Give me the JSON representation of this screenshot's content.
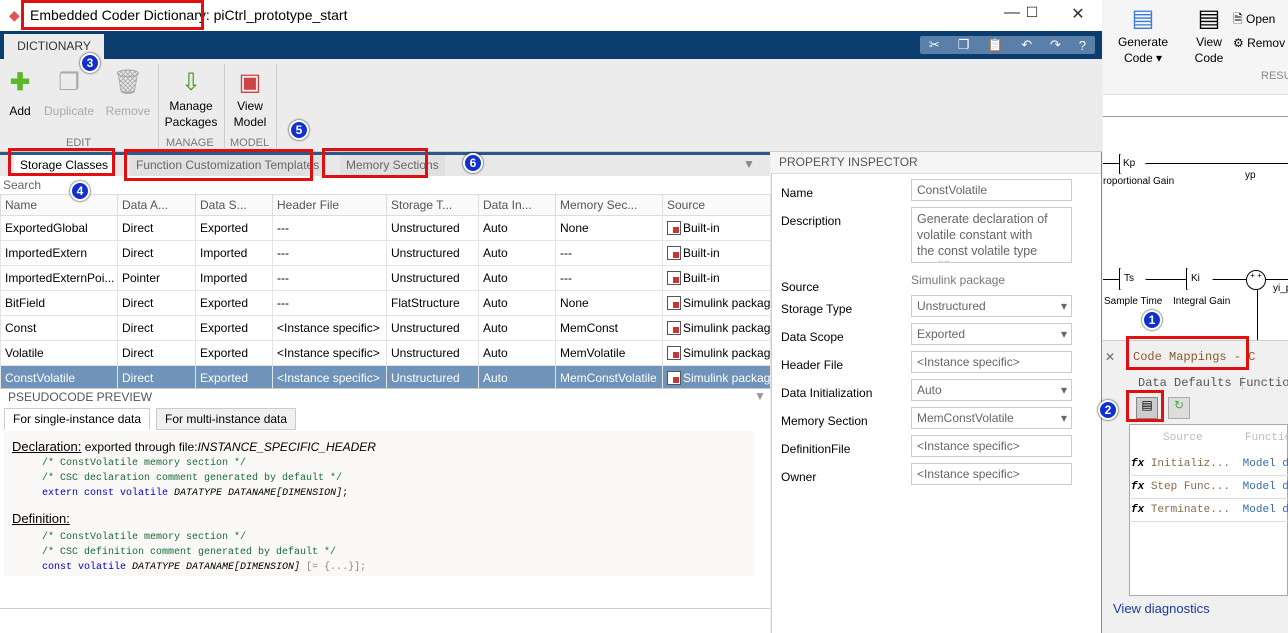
{
  "window": {
    "title": "Embedded Coder Dictionary: piCtrl_prototype_start",
    "tab": "DICTIONARY"
  },
  "ribbon": {
    "add": "Add",
    "duplicate": "Duplicate",
    "remove": "Remove",
    "edit_group": "EDIT",
    "manage_packages": [
      "Manage",
      "Packages"
    ],
    "manage_group": "MANAGE",
    "view_model": [
      "View",
      "Model"
    ],
    "model_group": "MODEL"
  },
  "tabs": [
    "Storage Classes",
    "Function Customization Templates",
    "Memory Sections"
  ],
  "search_placeholder": "Search",
  "table": {
    "headers": [
      "Name",
      "Data A...",
      "Data S...",
      "Header File",
      "Storage T...",
      "Data In...",
      "Memory Sec...",
      "Source"
    ],
    "rows": [
      [
        "ExportedGlobal",
        "Direct",
        "Exported",
        "---",
        "Unstructured",
        "Auto",
        "None",
        "Built-in"
      ],
      [
        "ImportedExtern",
        "Direct",
        "Imported",
        "---",
        "Unstructured",
        "Auto",
        "---",
        "Built-in"
      ],
      [
        "ImportedExternPoi...",
        "Pointer",
        "Imported",
        "---",
        "Unstructured",
        "Auto",
        "---",
        "Built-in"
      ],
      [
        "BitField",
        "Direct",
        "Exported",
        "---",
        "FlatStructure",
        "Auto",
        "None",
        "Simulink package"
      ],
      [
        "Const",
        "Direct",
        "Exported",
        "<Instance specific>",
        "Unstructured",
        "Auto",
        "MemConst",
        "Simulink package"
      ],
      [
        "Volatile",
        "Direct",
        "Exported",
        "<Instance specific>",
        "Unstructured",
        "Auto",
        "MemVolatile",
        "Simulink package"
      ],
      [
        "ConstVolatile",
        "Direct",
        "Exported",
        "<Instance specific>",
        "Unstructured",
        "Auto",
        "MemConstVolatile",
        "Simulink package"
      ]
    ],
    "selected_row": 6
  },
  "pseudocode": {
    "title": "PSEUDOCODE PREVIEW",
    "tabs": [
      "For single-instance data",
      "For multi-instance data"
    ],
    "declaration_label": "Declaration:",
    "declaration_text": "exported through file:",
    "declaration_file": "INSTANCE_SPECIFIC_HEADER",
    "decl_lines": [
      "/* ConstVolatile memory section */",
      "/* CSC declaration comment generated by default */"
    ],
    "decl_kw": "extern const volatile",
    "decl_code": "DATATYPE DATANAME[DIMENSION]",
    "decl_end": ";",
    "definition_label": "Definition:",
    "def_lines": [
      "/* ConstVolatile memory section */",
      "/* CSC definition comment generated by default */"
    ],
    "def_kw": "const volatile",
    "def_code": "DATATYPE DATANAME[DIMENSION]",
    "def_end": " [= {...}];"
  },
  "inspector": {
    "title": "PROPERTY INSPECTOR",
    "fields": [
      {
        "label": "Name",
        "value": "ConstVolatile"
      },
      {
        "label": "Description",
        "value": "Generate declaration of volatile constant with the const volatile type qualifier"
      },
      {
        "label": "Source",
        "value": "Simulink package"
      },
      {
        "label": "Storage Type",
        "value": "Unstructured"
      },
      {
        "label": "Data Scope",
        "value": "Exported"
      },
      {
        "label": "Header File",
        "value": "<Instance specific>"
      },
      {
        "label": "Data Initialization",
        "value": "Auto"
      },
      {
        "label": "Memory Section",
        "value": "MemConstVolatile"
      },
      {
        "label": "DefinitionFile",
        "value": "<Instance specific>"
      },
      {
        "label": "Owner",
        "value": "<Instance specific>"
      }
    ]
  },
  "background": {
    "generate_code": [
      "Generate",
      "Code ▾"
    ],
    "view_code": [
      "View",
      "Code"
    ],
    "open": "Open",
    "remove": "Remov",
    "results_group": "RESU",
    "blocks": {
      "kp": "Kp",
      "prop_gain": "roportional Gain",
      "yp": "yp",
      "ts": "Ts",
      "sample_time": "Sample Time",
      "ki": "Ki",
      "integral_gain": "Integral Gain",
      "yi": "yi_p"
    },
    "code_mappings": "Code Mappings - C",
    "cm_tabs": [
      "Data Defaults",
      "Function"
    ],
    "cm_headers": [
      "Source",
      "Function"
    ],
    "cm_rows": [
      [
        "Initializ...",
        "Model defa"
      ],
      [
        "Step Func...",
        "Model defa"
      ],
      [
        "Terminate...",
        "Model defa"
      ]
    ],
    "view_diagnostics": "View diagnostics"
  },
  "annotations": [
    "1",
    "2",
    "3",
    "4",
    "5",
    "6"
  ],
  "colors": {
    "band": "#0b3d6e",
    "selected_row": "#6f93b9",
    "highlight": "#e01010",
    "badge": "#1030d0"
  }
}
